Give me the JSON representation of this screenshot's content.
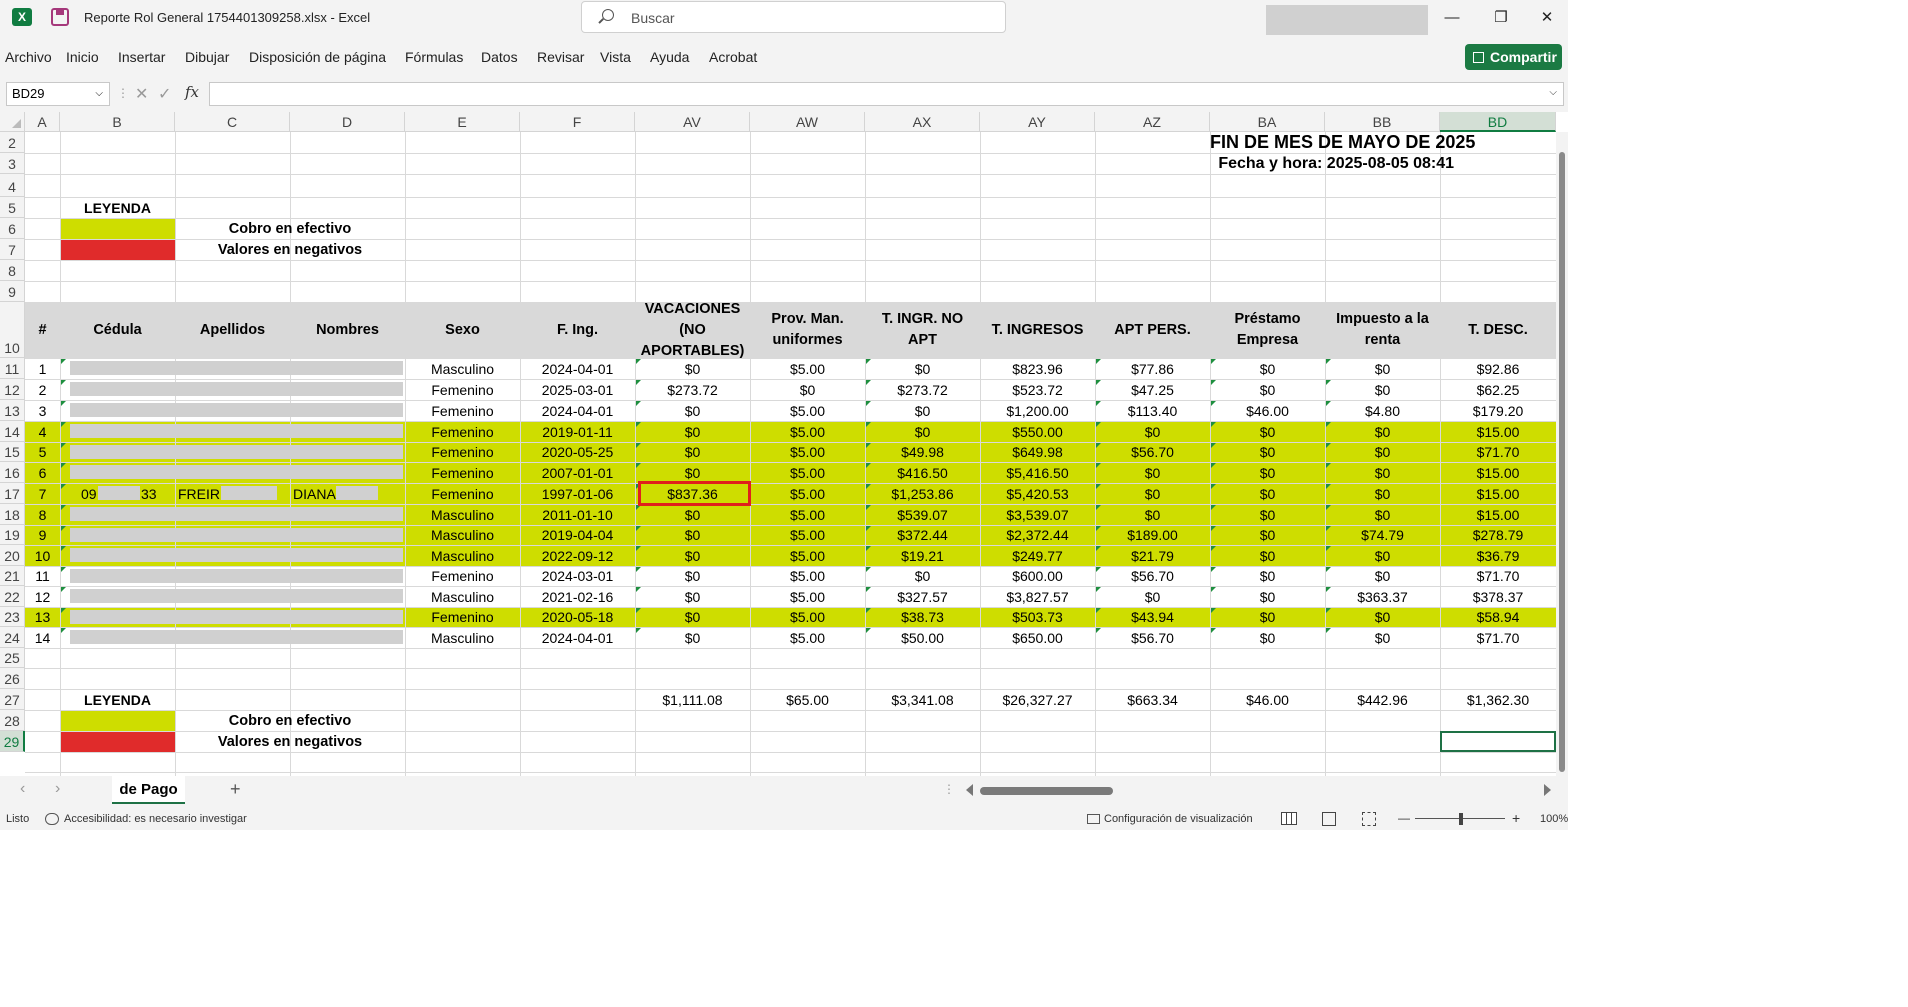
{
  "window": {
    "title": "Reporte Rol General 1754401309258.xlsx  -  Excel",
    "app_icon": "excel-icon",
    "search_placeholder": "Buscar",
    "minimize": "—",
    "maximize": "❐",
    "close": "✕"
  },
  "ribbon": {
    "menus": [
      "Archivo",
      "Inicio",
      "Insertar",
      "Dibujar",
      "Disposición de página",
      "Fórmulas",
      "Datos",
      "Revisar",
      "Vista",
      "Ayuda",
      "Acrobat"
    ],
    "share_label": "Compartir"
  },
  "formula_bar": {
    "name_box": "BD29",
    "cancel": "✕",
    "enter": "✓",
    "fx": "fx",
    "content": ""
  },
  "sheet": {
    "columns": [
      "A",
      "B",
      "C",
      "D",
      "E",
      "F",
      "AV",
      "AW",
      "AX",
      "AY",
      "AZ",
      "BA",
      "BB",
      "BD"
    ],
    "selected_column": "BD",
    "rows": [
      "2",
      "3",
      "4",
      "5",
      "6",
      "7",
      "8",
      "9",
      "10",
      "11",
      "12",
      "13",
      "14",
      "15",
      "16",
      "17",
      "18",
      "19",
      "20",
      "21",
      "22",
      "23",
      "24",
      "25",
      "26",
      "27",
      "28",
      "29"
    ],
    "selected_row": "29",
    "report_title": "FIN DE MES DE MAYO DE 2025",
    "report_datetime": "Fecha y hora: 2025-08-05 08:41",
    "legend_title": "LEYENDA",
    "legend_items": [
      "Cobro en efectivo",
      "Valores en negativos"
    ],
    "legend_colors": {
      "cash": "#cedd00",
      "negative": "#e02b2b"
    },
    "header": [
      "#",
      "Cédula",
      "Apellidos",
      "Nombres",
      "Sexo",
      "F. Ing.",
      "VACACIONES (NO APORTABLES)",
      "Prov. Man. uniformes",
      "T. INGR. NO APT",
      "T. INGRESOS",
      "APT PERS.",
      "Préstamo Empresa",
      "Impuesto a la renta",
      "T. DESC."
    ],
    "employees": [
      {
        "n": "1",
        "sexo": "Masculino",
        "fing": "2024-04-01",
        "vac": "$0",
        "prov": "$5.00",
        "tingr_no_apt": "$0",
        "tingresos": "$823.96",
        "apt": "$77.86",
        "prestamo": "$0",
        "impuesto": "$0",
        "tdesc": "$92.86",
        "cash": false
      },
      {
        "n": "2",
        "sexo": "Femenino",
        "fing": "2025-03-01",
        "vac": "$273.72",
        "prov": "$0",
        "tingr_no_apt": "$273.72",
        "tingresos": "$523.72",
        "apt": "$47.25",
        "prestamo": "$0",
        "impuesto": "$0",
        "tdesc": "$62.25",
        "cash": false
      },
      {
        "n": "3",
        "sexo": "Femenino",
        "fing": "2024-04-01",
        "vac": "$0",
        "prov": "$5.00",
        "tingr_no_apt": "$0",
        "tingresos": "$1,200.00",
        "apt": "$113.40",
        "prestamo": "$46.00",
        "impuesto": "$4.80",
        "tdesc": "$179.20",
        "cash": false
      },
      {
        "n": "4",
        "sexo": "Femenino",
        "fing": "2019-01-11",
        "vac": "$0",
        "prov": "$5.00",
        "tingr_no_apt": "$0",
        "tingresos": "$550.00",
        "apt": "$0",
        "prestamo": "$0",
        "impuesto": "$0",
        "tdesc": "$15.00",
        "cash": true
      },
      {
        "n": "5",
        "sexo": "Femenino",
        "fing": "2020-05-25",
        "vac": "$0",
        "prov": "$5.00",
        "tingr_no_apt": "$49.98",
        "tingresos": "$649.98",
        "apt": "$56.70",
        "prestamo": "$0",
        "impuesto": "$0",
        "tdesc": "$71.70",
        "cash": true
      },
      {
        "n": "6",
        "sexo": "Femenino",
        "fing": "2007-01-01",
        "vac": "$0",
        "prov": "$5.00",
        "tingr_no_apt": "$416.50",
        "tingresos": "$5,416.50",
        "apt": "$0",
        "prestamo": "$0",
        "impuesto": "$0",
        "tdesc": "$15.00",
        "cash": true
      },
      {
        "n": "7",
        "cedula": "09",
        "cedula_end": "33",
        "apellidos": "FREIRE",
        "nombres": "DIANA",
        "sexo": "Femenino",
        "fing": "1997-01-06",
        "vac": "$837.36",
        "prov": "$5.00",
        "tingr_no_apt": "$1,253.86",
        "tingresos": "$5,420.53",
        "apt": "$0",
        "prestamo": "$0",
        "impuesto": "$0",
        "tdesc": "$15.00",
        "cash": true
      },
      {
        "n": "8",
        "sexo": "Masculino",
        "fing": "2011-01-10",
        "vac": "$0",
        "prov": "$5.00",
        "tingr_no_apt": "$539.07",
        "tingresos": "$3,539.07",
        "apt": "$0",
        "prestamo": "$0",
        "impuesto": "$0",
        "tdesc": "$15.00",
        "cash": true
      },
      {
        "n": "9",
        "sexo": "Masculino",
        "fing": "2019-04-04",
        "vac": "$0",
        "prov": "$5.00",
        "tingr_no_apt": "$372.44",
        "tingresos": "$2,372.44",
        "apt": "$189.00",
        "prestamo": "$0",
        "impuesto": "$74.79",
        "tdesc": "$278.79",
        "cash": true
      },
      {
        "n": "10",
        "sexo": "Masculino",
        "fing": "2022-09-12",
        "vac": "$0",
        "prov": "$5.00",
        "tingr_no_apt": "$19.21",
        "tingresos": "$249.77",
        "apt": "$21.79",
        "prestamo": "$0",
        "impuesto": "$0",
        "tdesc": "$36.79",
        "cash": true
      },
      {
        "n": "11",
        "sexo": "Femenino",
        "fing": "2024-03-01",
        "vac": "$0",
        "prov": "$5.00",
        "tingr_no_apt": "$0",
        "tingresos": "$600.00",
        "apt": "$56.70",
        "prestamo": "$0",
        "impuesto": "$0",
        "tdesc": "$71.70",
        "cash": false
      },
      {
        "n": "12",
        "sexo": "Masculino",
        "fing": "2021-02-16",
        "vac": "$0",
        "prov": "$5.00",
        "tingr_no_apt": "$327.57",
        "tingresos": "$3,827.57",
        "apt": "$0",
        "prestamo": "$0",
        "impuesto": "$363.37",
        "tdesc": "$378.37",
        "cash": false
      },
      {
        "n": "13",
        "sexo": "Femenino",
        "fing": "2020-05-18",
        "vac": "$0",
        "prov": "$5.00",
        "tingr_no_apt": "$38.73",
        "tingresos": "$503.73",
        "apt": "$43.94",
        "prestamo": "$0",
        "impuesto": "$0",
        "tdesc": "$58.94",
        "cash": true
      },
      {
        "n": "14",
        "sexo": "Masculino",
        "fing": "2024-04-01",
        "vac": "$0",
        "prov": "$5.00",
        "tingr_no_apt": "$50.00",
        "tingresos": "$650.00",
        "apt": "$56.70",
        "prestamo": "$0",
        "impuesto": "$0",
        "tdesc": "$71.70",
        "cash": false
      }
    ],
    "totals": {
      "vac": "$1,111.08",
      "prov": "$65.00",
      "tingr_no_apt": "$3,341.08",
      "tingresos": "$26,327.27",
      "apt": "$663.34",
      "prestamo": "$46.00",
      "impuesto": "$442.96",
      "tdesc": "$1,362.30"
    },
    "highlighted_cell": "$837.36"
  },
  "tabs": {
    "active": "de Pago",
    "add": "+",
    "prev": "‹",
    "next": "›"
  },
  "status": {
    "ready": "Listo",
    "accessibility": "Accesibilidad: es necesario investigar",
    "display_settings": "Configuración de visualización",
    "zoom": "100%",
    "minus": "—",
    "plus": "+"
  }
}
